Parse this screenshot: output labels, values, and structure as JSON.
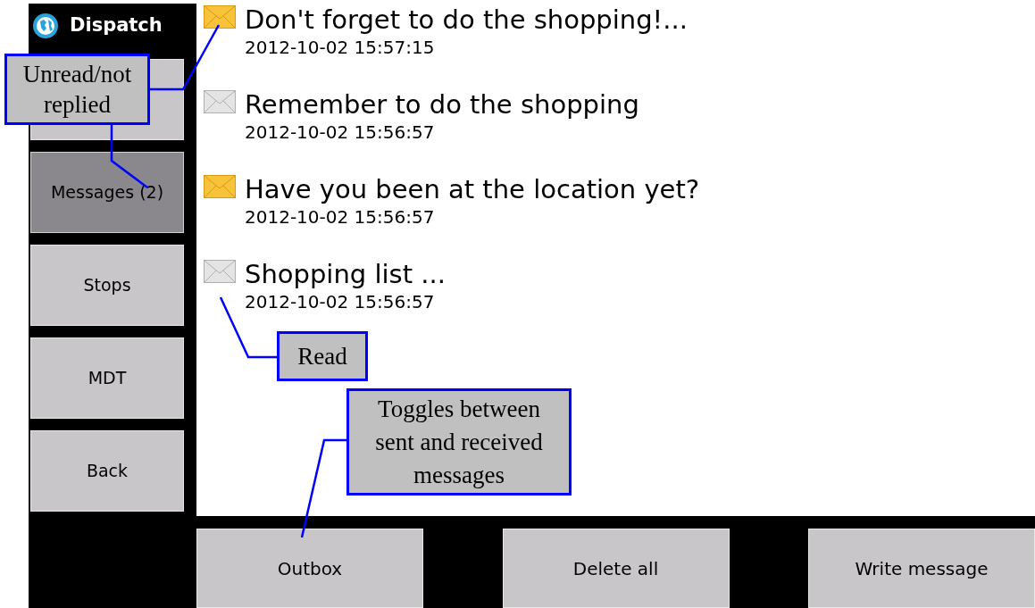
{
  "app": {
    "title": "Dispatch"
  },
  "sidebar": {
    "items": [
      {
        "selected": false
      },
      {
        "label": "Messages (2)",
        "selected": true
      },
      {
        "label": "Stops",
        "selected": false
      },
      {
        "label": "MDT",
        "selected": false
      },
      {
        "label": "Back",
        "selected": false
      }
    ]
  },
  "messages": [
    {
      "subject": "Don't forget to do the shopping!...",
      "time": "2012-10-02 15:57:15",
      "read": false
    },
    {
      "subject": "Remember to do the shopping",
      "time": "2012-10-02 15:56:57",
      "read": true
    },
    {
      "subject": "Have you been at the location yet?",
      "time": "2012-10-02 15:56:57",
      "read": false
    },
    {
      "subject": "Shopping list ...",
      "time": "2012-10-02 15:56:57",
      "read": true
    }
  ],
  "buttons": [
    "Outbox",
    "Delete all",
    "Write message"
  ],
  "callouts": [
    "Unread/not replied",
    "Read",
    "Toggles between sent and received messages"
  ]
}
